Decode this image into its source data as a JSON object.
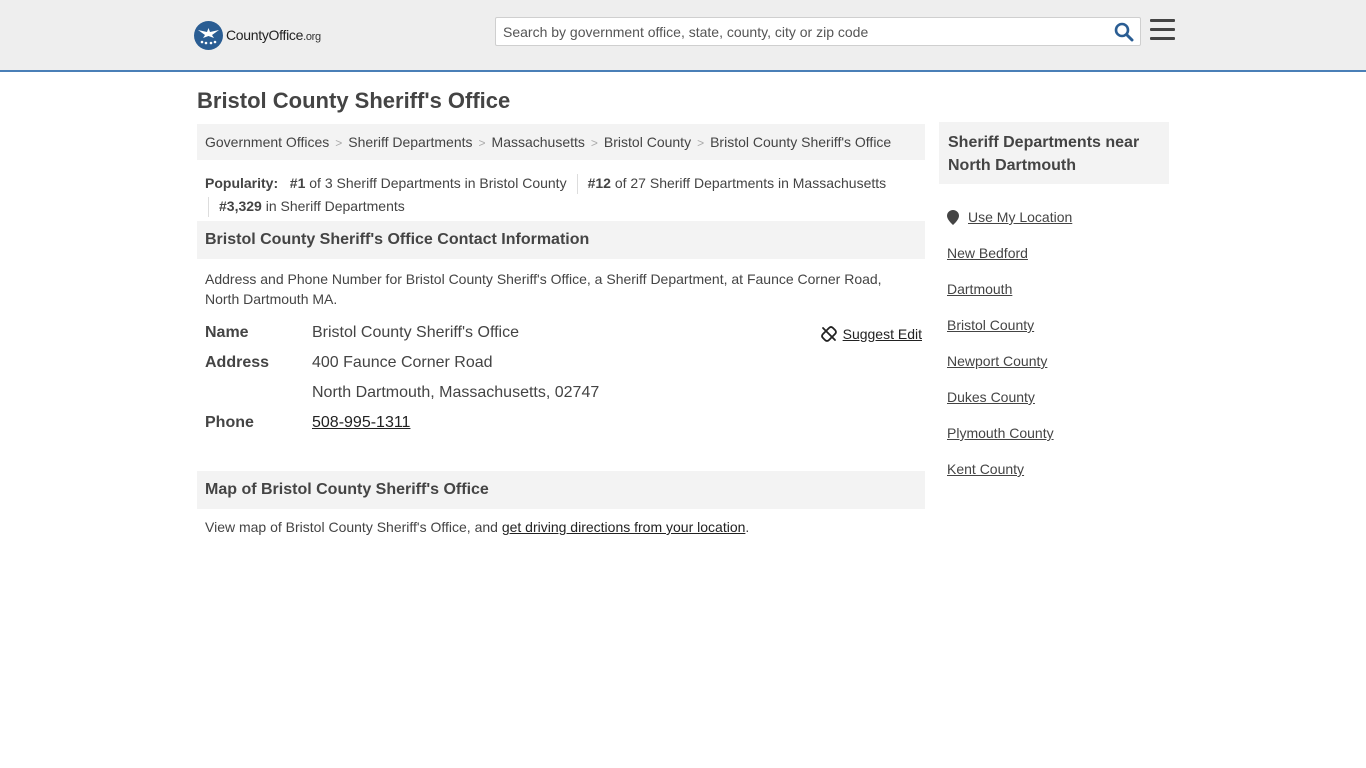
{
  "header": {
    "logo_brand": "CountyOffice",
    "logo_tld": ".org",
    "search_placeholder": "Search by government office, state, county, city or zip code"
  },
  "page_title": "Bristol County Sheriff's Office",
  "breadcrumb": [
    "Government Offices",
    "Sheriff Departments",
    "Massachusetts",
    "Bristol County",
    "Bristol County Sheriff's Office"
  ],
  "popularity": {
    "label": "Popularity:",
    "rank1": "#1",
    "rank1_text": "of 3 Sheriff Departments in Bristol County",
    "rank2": "#12",
    "rank2_text": "of 27 Sheriff Departments in Massachusetts",
    "rank3": "#3,329",
    "rank3_text": "in Sheriff Departments"
  },
  "contact": {
    "heading": "Bristol County Sheriff's Office Contact Information",
    "description": "Address and Phone Number for Bristol County Sheriff's Office, a Sheriff Department, at Faunce Corner Road, North Dartmouth MA.",
    "suggest_edit": "Suggest Edit",
    "name_label": "Name",
    "name_value": "Bristol County Sheriff's Office",
    "address_label": "Address",
    "address_line1": "400 Faunce Corner Road",
    "address_line2": "North Dartmouth, Massachusetts, 02747",
    "phone_label": "Phone",
    "phone_value": "508-995-1311"
  },
  "map": {
    "heading": "Map of Bristol County Sheriff's Office",
    "text_before": "View map of Bristol County Sheriff's Office, and ",
    "link": "get driving directions from your location",
    "text_after": "."
  },
  "sidebar": {
    "heading": "Sheriff Departments near North Dartmouth",
    "use_location": "Use My Location",
    "items": [
      "New Bedford",
      "Dartmouth",
      "Bristol County",
      "Newport County",
      "Dukes County",
      "Plymouth County",
      "Kent County"
    ]
  },
  "colors": {
    "header_bg": "#eeeeee",
    "header_border": "#4a7fb7",
    "logo_blue": "#2a5d93",
    "search_icon": "#2a5d93"
  }
}
